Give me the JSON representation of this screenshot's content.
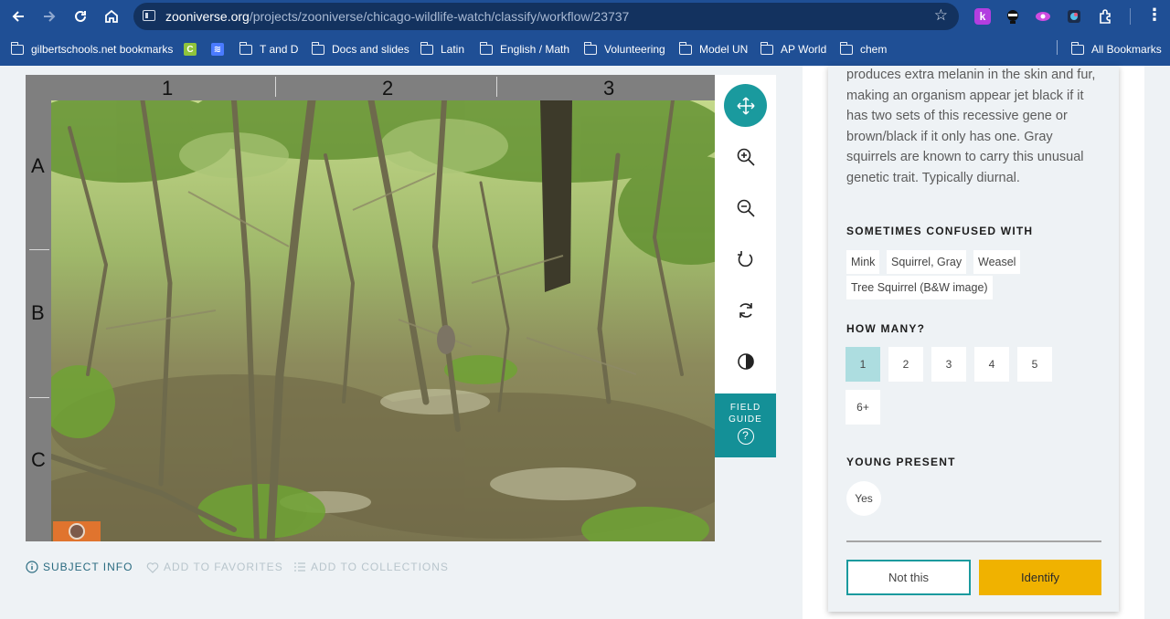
{
  "browser": {
    "url_host": "zooniverse.org",
    "url_path": "/projects/zooniverse/chicago-wildlife-watch/classify/workflow/23737",
    "bookmarks": [
      {
        "label": "gilbertschools.net bookmarks",
        "icon": "folder-icon"
      },
      {
        "label": "",
        "icon": "canva-icon",
        "color": "#8fc43c"
      },
      {
        "label": "",
        "icon": "app-icon",
        "color": "#4a7bff"
      },
      {
        "label": "T and D",
        "icon": "folder-icon"
      },
      {
        "label": "Docs and slides",
        "icon": "folder-icon"
      },
      {
        "label": "Latin",
        "icon": "folder-icon"
      },
      {
        "label": "English / Math",
        "icon": "folder-icon"
      },
      {
        "label": "Volunteering",
        "icon": "folder-icon"
      },
      {
        "label": "Model UN",
        "icon": "folder-icon"
      },
      {
        "label": "AP World",
        "icon": "folder-icon"
      },
      {
        "label": "chem",
        "icon": "folder-icon"
      }
    ],
    "all_bookmarks": "All Bookmarks",
    "ext_colors": [
      "#b23ee0",
      "#222222",
      "#c944d8",
      "#3c6fc0",
      "#ffffff"
    ]
  },
  "viewer": {
    "columns": [
      "1",
      "2",
      "3"
    ],
    "rows": [
      "A",
      "B",
      "C"
    ],
    "colors": {
      "frame": "#7f7f7f",
      "active_tool": "#1a9a9e",
      "field_guide": "#149097"
    },
    "tools": [
      "move-icon",
      "zoom-in-icon",
      "zoom-out-icon",
      "rotate-icon",
      "reset-icon",
      "invert-icon"
    ],
    "field_guide_label": "FIELD GUIDE",
    "field_guide_q": "?"
  },
  "subject_actions": {
    "info": "SUBJECT INFO",
    "favorites": "ADD TO FAVORITES",
    "collections": "ADD TO COLLECTIONS"
  },
  "panel": {
    "description": "produces extra melanin in the skin and fur, making an organism appear jet black if it has two sets of this recessive gene or brown/black if it only has one. Gray squirrels are known to carry this unusual genetic trait. Typically diurnal.",
    "confused_heading": "SOMETIMES CONFUSED WITH",
    "confused": [
      "Mink",
      "Squirrel, Gray",
      "Weasel",
      "Tree Squirrel (B&W image)"
    ],
    "how_many_heading": "HOW MANY?",
    "how_many": [
      "1",
      "2",
      "3",
      "4",
      "5",
      "6+"
    ],
    "how_many_selected": "1",
    "young_heading": "YOUNG PRESENT",
    "young_option": "Yes",
    "not_this": "Not this",
    "identify": "Identify",
    "colors": {
      "selected": "#addde0",
      "identify": "#f0b200",
      "teal": "#1a9a9e"
    }
  }
}
